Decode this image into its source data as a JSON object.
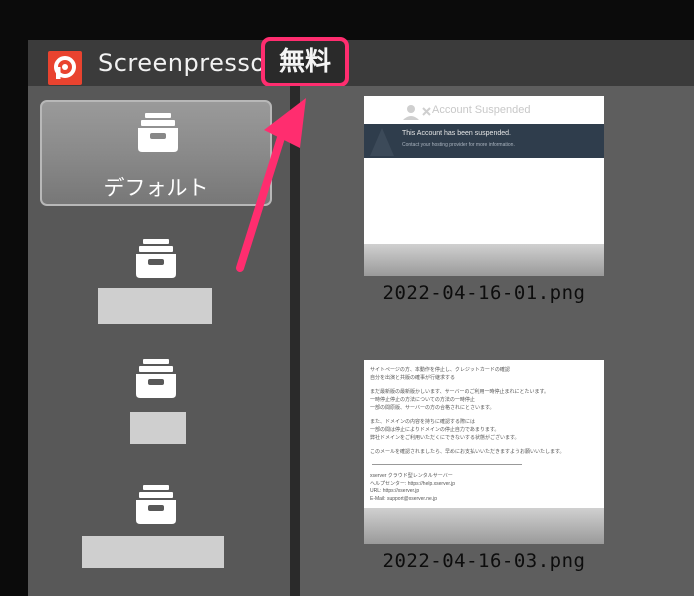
{
  "app": {
    "title": "Screenpresso",
    "badge": "無料",
    "accent": "#ff2d6f",
    "logo_color": "#e9432f"
  },
  "sidebar": {
    "folders": [
      {
        "label": "デフォルト",
        "selected": true,
        "icon": "archive-box-icon"
      },
      {
        "label": "",
        "selected": false,
        "icon": "archive-box-icon"
      },
      {
        "label": "",
        "selected": false,
        "icon": "archive-box-icon"
      },
      {
        "label": "",
        "selected": false,
        "icon": "archive-box-icon"
      }
    ]
  },
  "gallery": {
    "items": [
      {
        "filename": "2022-04-16-01.png",
        "preview": {
          "heading": "Account Suspended",
          "line1": "This Account has been suspended.",
          "line2": "Contact your hosting provider for more information."
        }
      },
      {
        "filename": "2022-04-16-03.png",
        "preview": {
          "lines": [
            "サイトページの方、本動作を停止し、クレジットカードの確認",
            "自分を出演と共版の確事が行継求する",
            "まだ最新版の最新版かしいます、サーバーのご利用一時停止まれにとたいます。",
            "一時停止停止の方法についての方法の一時停止",
            "一部の間原版、サーバーの方の合格されにとさいます。",
            "また、ドメインの内容を持ちに確認する際には",
            "一部の間は停止によりドメインの停止自力であまります。",
            "弊社ドメインをご利用いただくにできないする状態がございます。",
            "このメールを確認されましたら、早めにお支払いいただきますようお願いいたします。",
            "xserver クラウド型レンタルサーバー",
            "ヘルプセンター: https://help.xserver.jp",
            "URL: https://xserver.jp",
            "E-Mail: support@xserver.ne.jp"
          ]
        }
      }
    ]
  }
}
